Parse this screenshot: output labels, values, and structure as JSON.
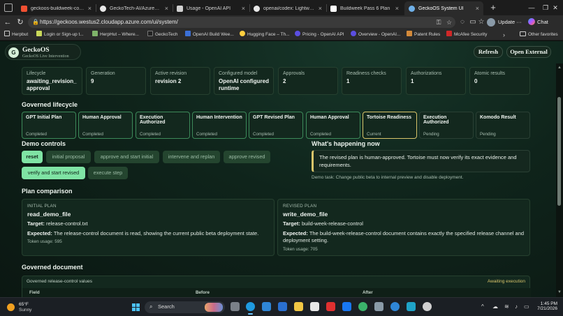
{
  "browser": {
    "tabs": [
      {
        "label": "geckoos-buildweek-core-ip",
        "active": false
      },
      {
        "label": "GeckoTech-AI/AzureVM: De",
        "active": false
      },
      {
        "label": "Usage - OpenAI API",
        "active": false
      },
      {
        "label": "openai/codex: Lightweight",
        "active": false
      },
      {
        "label": "Buildweek Pass 6 Plan",
        "active": false
      },
      {
        "label": "GeckoOS System UI",
        "active": true
      }
    ],
    "url": "https://geckoos.westus2.cloudapp.azure.com/ui/system/",
    "update_label": "Update",
    "chat_label": "Chat",
    "bookmarks": [
      "Herpbut",
      "Login or Sign-up t...",
      "HerpHut – Where...",
      "GeckoTech",
      "OpenAI Build Wee...",
      "Hugging Face – Th...",
      "Pricing - OpenAI API",
      "Overview - OpenAI...",
      "Patent Rules",
      "McAfee Security"
    ],
    "other_favorites": "Other favorites"
  },
  "app": {
    "brand_name": "GeckoOS",
    "brand_logo": "G",
    "brand_subtitle": "GeckoOS Live Intervention",
    "refresh_label": "Refresh",
    "open_external_label": "Open External",
    "stats": [
      {
        "label": "Lifecycle",
        "value": "awaiting_revision_approval"
      },
      {
        "label": "Generation",
        "value": "9"
      },
      {
        "label": "Active revision",
        "value": "revision 2"
      },
      {
        "label": "Configured model",
        "value": "OpenAI configured runtime"
      },
      {
        "label": "Approvals",
        "value": "2"
      },
      {
        "label": "Readiness checks",
        "value": "1"
      },
      {
        "label": "Authorizations",
        "value": "1"
      },
      {
        "label": "Atomic results",
        "value": "0"
      }
    ],
    "lifecycle_title": "Governed lifecycle",
    "lifecycle_steps": [
      {
        "name": "GPT Initial Plan",
        "status": "Completed"
      },
      {
        "name": "Human Approval",
        "status": "Completed"
      },
      {
        "name": "Execution Authorized",
        "status": "Completed"
      },
      {
        "name": "Human Intervention",
        "status": "Completed"
      },
      {
        "name": "GPT Revised Plan",
        "status": "Completed"
      },
      {
        "name": "Human Approval",
        "status": "Completed"
      },
      {
        "name": "Tortoise Readiness",
        "status": "Current"
      },
      {
        "name": "Execution Authorized",
        "status": "Pending"
      },
      {
        "name": "Komodo Result",
        "status": "Pending"
      }
    ],
    "demo_title": "Demo controls",
    "demo_controls": [
      "reset",
      "initial proposal",
      "approve and start initial",
      "intervene and replan",
      "approve revised",
      "verify and start revised",
      "execute step"
    ],
    "happening_title": "What's happening now",
    "happening_text": "The revised plan is human-approved. Tortoise must now verify its exact evidence and requirements.",
    "demo_task": "Demo task: Change public beta to internal preview and disable deployment.",
    "comparison_title": "Plan comparison",
    "initial_plan": {
      "tag": "INITIAL PLAN",
      "name": "read_demo_file",
      "target_label": "Target:",
      "target": "release-control.txt",
      "expected_label": "Expected:",
      "expected": "The release-control document is read, showing the current public beta deployment state.",
      "tokens": "Token usage: 595"
    },
    "revised_plan": {
      "tag": "REVISED PLAN",
      "name": "write_demo_file",
      "target_label": "Target:",
      "target": "build-week-release-control",
      "expected_label": "Expected:",
      "expected": "The build-week-release-control document contains exactly the specified release channel and deployment setting.",
      "tokens": "Token usage: 705"
    },
    "document_title": "Governed document",
    "document_card_title": "Governed release-control values",
    "document_status": "Awaiting execution",
    "document_columns": [
      "Field",
      "Before",
      "After"
    ]
  },
  "taskbar": {
    "temp": "65°F",
    "weather": "Sunny",
    "search_label": "Search",
    "time": "1:45 PM",
    "date": "7/21/2026"
  }
}
